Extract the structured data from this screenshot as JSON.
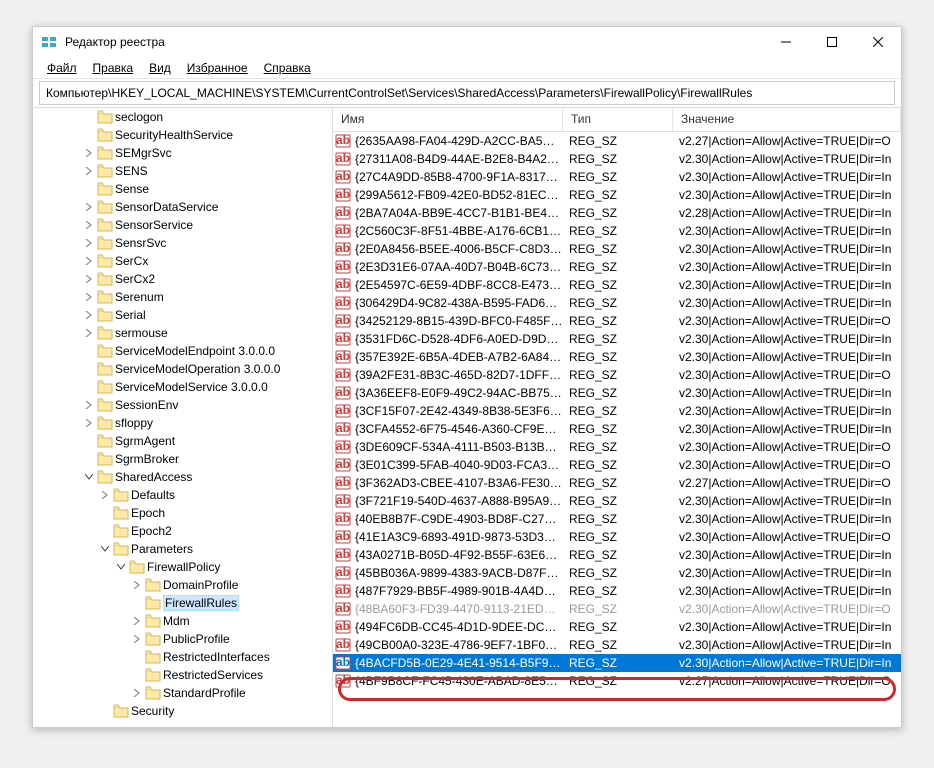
{
  "window": {
    "title": "Редактор реестра",
    "buttons": {
      "min": "—",
      "max": "☐",
      "close": "✕"
    }
  },
  "menu": {
    "file": "Файл",
    "edit": "Правка",
    "view": "Вид",
    "fav": "Избранное",
    "help": "Справка"
  },
  "address": "Компьютер\\HKEY_LOCAL_MACHINE\\SYSTEM\\CurrentControlSet\\Services\\SharedAccess\\Parameters\\FirewallPolicy\\FirewallRules",
  "columns": {
    "name": "Имя",
    "type": "Тип",
    "value": "Значение"
  },
  "tree": [
    {
      "indent": 3,
      "exp": "",
      "label": "seclogon"
    },
    {
      "indent": 3,
      "exp": "",
      "label": "SecurityHealthService"
    },
    {
      "indent": 3,
      "exp": ">",
      "label": "SEMgrSvc"
    },
    {
      "indent": 3,
      "exp": ">",
      "label": "SENS"
    },
    {
      "indent": 3,
      "exp": "",
      "label": "Sense"
    },
    {
      "indent": 3,
      "exp": ">",
      "label": "SensorDataService"
    },
    {
      "indent": 3,
      "exp": ">",
      "label": "SensorService"
    },
    {
      "indent": 3,
      "exp": ">",
      "label": "SensrSvc"
    },
    {
      "indent": 3,
      "exp": ">",
      "label": "SerCx"
    },
    {
      "indent": 3,
      "exp": ">",
      "label": "SerCx2"
    },
    {
      "indent": 3,
      "exp": ">",
      "label": "Serenum"
    },
    {
      "indent": 3,
      "exp": ">",
      "label": "Serial"
    },
    {
      "indent": 3,
      "exp": ">",
      "label": "sermouse"
    },
    {
      "indent": 3,
      "exp": "",
      "label": "ServiceModelEndpoint 3.0.0.0"
    },
    {
      "indent": 3,
      "exp": "",
      "label": "ServiceModelOperation 3.0.0.0"
    },
    {
      "indent": 3,
      "exp": "",
      "label": "ServiceModelService 3.0.0.0"
    },
    {
      "indent": 3,
      "exp": ">",
      "label": "SessionEnv"
    },
    {
      "indent": 3,
      "exp": ">",
      "label": "sfloppy"
    },
    {
      "indent": 3,
      "exp": "",
      "label": "SgrmAgent"
    },
    {
      "indent": 3,
      "exp": "",
      "label": "SgrmBroker"
    },
    {
      "indent": 3,
      "exp": "v",
      "label": "SharedAccess"
    },
    {
      "indent": 4,
      "exp": ">",
      "label": "Defaults"
    },
    {
      "indent": 4,
      "exp": "",
      "label": "Epoch"
    },
    {
      "indent": 4,
      "exp": "",
      "label": "Epoch2"
    },
    {
      "indent": 4,
      "exp": "v",
      "label": "Parameters"
    },
    {
      "indent": 5,
      "exp": "v",
      "label": "FirewallPolicy"
    },
    {
      "indent": 6,
      "exp": ">",
      "label": "DomainProfile"
    },
    {
      "indent": 6,
      "exp": "",
      "label": "FirewallRules",
      "selected": true
    },
    {
      "indent": 6,
      "exp": ">",
      "label": "Mdm"
    },
    {
      "indent": 6,
      "exp": ">",
      "label": "PublicProfile"
    },
    {
      "indent": 6,
      "exp": "",
      "label": "RestrictedInterfaces"
    },
    {
      "indent": 6,
      "exp": "",
      "label": "RestrictedServices"
    },
    {
      "indent": 6,
      "exp": ">",
      "label": "StandardProfile"
    },
    {
      "indent": 4,
      "exp": "",
      "label": "Security"
    }
  ],
  "rows": [
    {
      "name": "{2635AA98-FA04-429D-A2CC-BA5…",
      "type": "REG_SZ",
      "value": "v2.27|Action=Allow|Active=TRUE|Dir=O"
    },
    {
      "name": "{27311A08-B4D9-44AE-B2E8-B4A2…",
      "type": "REG_SZ",
      "value": "v2.30|Action=Allow|Active=TRUE|Dir=In"
    },
    {
      "name": "{27C4A9DD-85B8-4700-9F1A-8317…",
      "type": "REG_SZ",
      "value": "v2.30|Action=Allow|Active=TRUE|Dir=In"
    },
    {
      "name": "{299A5612-FB09-42E0-BD52-81EC…",
      "type": "REG_SZ",
      "value": "v2.30|Action=Allow|Active=TRUE|Dir=In"
    },
    {
      "name": "{2BA7A04A-BB9E-4CC7-B1B1-BE4…",
      "type": "REG_SZ",
      "value": "v2.28|Action=Allow|Active=TRUE|Dir=In"
    },
    {
      "name": "{2C560C3F-8F51-4BBE-A176-6CB1…",
      "type": "REG_SZ",
      "value": "v2.30|Action=Allow|Active=TRUE|Dir=In"
    },
    {
      "name": "{2E0A8456-B5EE-4006-B5CF-C8D3…",
      "type": "REG_SZ",
      "value": "v2.30|Action=Allow|Active=TRUE|Dir=In"
    },
    {
      "name": "{2E3D31E6-07AA-40D7-B04B-6C73…",
      "type": "REG_SZ",
      "value": "v2.30|Action=Allow|Active=TRUE|Dir=In"
    },
    {
      "name": "{2E54597C-6E59-4DBF-8CC8-E473…",
      "type": "REG_SZ",
      "value": "v2.30|Action=Allow|Active=TRUE|Dir=In"
    },
    {
      "name": "{306429D4-9C82-438A-B595-FAD6…",
      "type": "REG_SZ",
      "value": "v2.30|Action=Allow|Active=TRUE|Dir=In"
    },
    {
      "name": "{34252129-8B15-439D-BFC0-F485F…",
      "type": "REG_SZ",
      "value": "v2.30|Action=Allow|Active=TRUE|Dir=O"
    },
    {
      "name": "{3531FD6C-D528-4DF6-A0ED-D9D…",
      "type": "REG_SZ",
      "value": "v2.30|Action=Allow|Active=TRUE|Dir=In"
    },
    {
      "name": "{357E392E-6B5A-4DEB-A7B2-6A84…",
      "type": "REG_SZ",
      "value": "v2.30|Action=Allow|Active=TRUE|Dir=In"
    },
    {
      "name": "{39A2FE31-8B3C-465D-82D7-1DFF…",
      "type": "REG_SZ",
      "value": "v2.30|Action=Allow|Active=TRUE|Dir=O"
    },
    {
      "name": "{3A36EEF8-E0F9-49C2-94AC-BB75…",
      "type": "REG_SZ",
      "value": "v2.30|Action=Allow|Active=TRUE|Dir=In"
    },
    {
      "name": "{3CF15F07-2E42-4349-8B38-5E3F6…",
      "type": "REG_SZ",
      "value": "v2.30|Action=Allow|Active=TRUE|Dir=In"
    },
    {
      "name": "{3CFA4552-6F75-4546-A360-CF9E8…",
      "type": "REG_SZ",
      "value": "v2.30|Action=Allow|Active=TRUE|Dir=In"
    },
    {
      "name": "{3DE609CF-534A-4111-B503-B13B…",
      "type": "REG_SZ",
      "value": "v2.30|Action=Allow|Active=TRUE|Dir=O"
    },
    {
      "name": "{3E01C399-5FAB-4040-9D03-FCA3…",
      "type": "REG_SZ",
      "value": "v2.30|Action=Allow|Active=TRUE|Dir=O"
    },
    {
      "name": "{3F362AD3-CBEE-4107-B3A6-FE30…",
      "type": "REG_SZ",
      "value": "v2.27|Action=Allow|Active=TRUE|Dir=O"
    },
    {
      "name": "{3F721F19-540D-4637-A888-B95A9…",
      "type": "REG_SZ",
      "value": "v2.30|Action=Allow|Active=TRUE|Dir=In"
    },
    {
      "name": "{40EB8B7F-C9DE-4903-BD8F-C27A…",
      "type": "REG_SZ",
      "value": "v2.30|Action=Allow|Active=TRUE|Dir=In"
    },
    {
      "name": "{41E1A3C9-6893-491D-9873-53D3E…",
      "type": "REG_SZ",
      "value": "v2.30|Action=Allow|Active=TRUE|Dir=O"
    },
    {
      "name": "{43A0271B-B05D-4F92-B55F-63E6E…",
      "type": "REG_SZ",
      "value": "v2.30|Action=Allow|Active=TRUE|Dir=In"
    },
    {
      "name": "{45BB036A-9899-4383-9ACB-D87F…",
      "type": "REG_SZ",
      "value": "v2.30|Action=Allow|Active=TRUE|Dir=In"
    },
    {
      "name": "{487F7929-BB5F-4989-901B-4A4D…",
      "type": "REG_SZ",
      "value": "v2.30|Action=Allow|Active=TRUE|Dir=In"
    },
    {
      "name": "{48BA60F3-FD39-4470-9113-21EDB…",
      "type": "REG_SZ",
      "value": "v2.30|Action=Allow|Active=TRUE|Dir=O",
      "fade": true
    },
    {
      "name": "{494FC6DB-CC45-4D1D-9DEE-DC7…",
      "type": "REG_SZ",
      "value": "v2.30|Action=Allow|Active=TRUE|Dir=In"
    },
    {
      "name": "{49CB00A0-323E-4786-9EF7-1BF0…",
      "type": "REG_SZ",
      "value": "v2.30|Action=Allow|Active=TRUE|Dir=In"
    },
    {
      "name": "{4BACFD5B-0E29-4E41-9514-B5F9…",
      "type": "REG_SZ",
      "value": "v2.30|Action=Allow|Active=TRUE|Dir=In",
      "selected": true
    },
    {
      "name": "{4BF9B8CF-FC45-430E-ABAD-8E55…",
      "type": "REG_SZ",
      "value": "v2.27|Action=Allow|Active=TRUE|Dir=O"
    }
  ]
}
